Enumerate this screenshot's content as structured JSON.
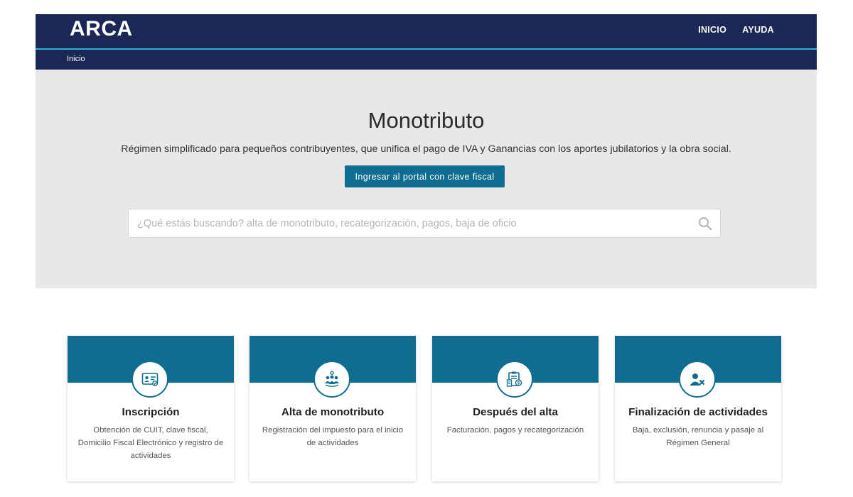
{
  "header": {
    "logo": "ARCA",
    "nav": [
      "INICIO",
      "AYUDA"
    ],
    "breadcrumb": "Inicio"
  },
  "hero": {
    "title": "Monotributo",
    "subtitle": "Régimen simplificado para pequeños contribuyentes, que unifica el pago de IVA y Ganancias con los aportes jubilatorios y la obra social.",
    "cta_label": "Ingresar al portal con clave fiscal",
    "search": {
      "placeholder": "¿Qué estás buscando? alta de monotributo, recategorización, pagos, baja de oficio",
      "value": "",
      "icon": "search-icon"
    }
  },
  "cards": [
    {
      "icon": "id-card-icon",
      "title": "Inscripción",
      "description": "Obtención de CUIT, clave fiscal, Domicilio Fiscal Electrónico y registro de actividades"
    },
    {
      "icon": "people-icon",
      "title": "Alta de monotributo",
      "description": "Registración del impuesto para el inicio de actividades"
    },
    {
      "icon": "invoice-icon",
      "title": "Después del alta",
      "description": "Facturación, pagos y recategorización"
    },
    {
      "icon": "user-remove-icon",
      "title": "Finalización de actividades",
      "description": "Baja, exclusión, renuncia y pasaje al Régimen General"
    }
  ],
  "colors": {
    "header_bg": "#1b2856",
    "accent": "#106d91",
    "hero_bg": "#e8e8e8",
    "header_line": "#2fb0d4"
  }
}
